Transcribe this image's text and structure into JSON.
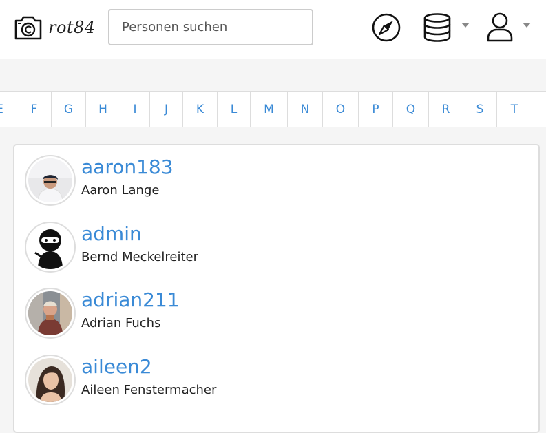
{
  "brand": {
    "name": "rot84",
    "logo_icon": "camera-copyright-icon"
  },
  "search": {
    "placeholder": "Personen suchen",
    "value": ""
  },
  "nav": {
    "icons": [
      "compass-icon",
      "database-icon",
      "user-icon"
    ]
  },
  "alphabet": [
    "E",
    "F",
    "G",
    "H",
    "I",
    "J",
    "K",
    "L",
    "M",
    "N",
    "O",
    "P",
    "Q",
    "R",
    "S",
    "T"
  ],
  "users": [
    {
      "username": "aaron183",
      "name": "Aaron Lange"
    },
    {
      "username": "admin",
      "name": "Bernd Meckelreiter"
    },
    {
      "username": "adrian211",
      "name": "Adrian Fuchs"
    },
    {
      "username": "aileen2",
      "name": "Aileen Fenstermacher"
    }
  ],
  "colors": {
    "link": "#3a8ad6",
    "border": "#dddddd",
    "page_bg": "#f5f5f5"
  }
}
